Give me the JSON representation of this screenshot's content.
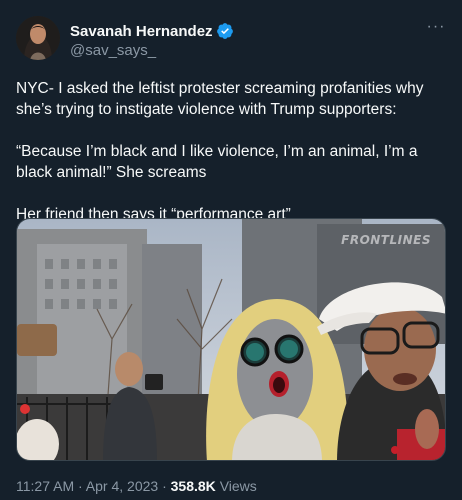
{
  "author": {
    "display_name": "Savanah Hernandez",
    "handle": "@sav_says_",
    "verified": true
  },
  "tweet": {
    "paragraphs": [
      "NYC- I asked the leftist protester screaming profanities why she’s trying to instigate violence with Trump supporters:",
      "“Because I’m black and I like violence, I’m an animal, I’m a black animal!” She screams",
      "Her friend then says it “performance art”"
    ],
    "more_icon": "more-horizontal-icon"
  },
  "media": {
    "watermark": "FRONTLINES"
  },
  "meta": {
    "time": "11:27 AM",
    "date": "Apr 4, 2023",
    "views_count": "358.8K",
    "views_label": "Views"
  },
  "colors": {
    "background": "#15202b",
    "text_primary": "#f7f9f9",
    "text_secondary": "#8b98a5",
    "verified_blue": "#1d9bf0"
  }
}
